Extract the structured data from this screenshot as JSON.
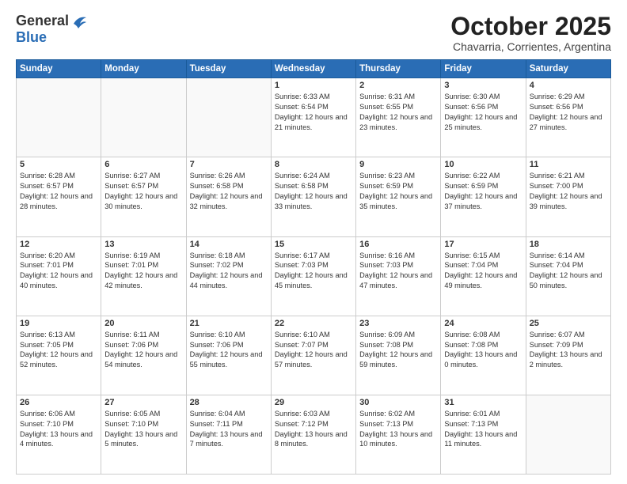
{
  "logo": {
    "general": "General",
    "blue": "Blue"
  },
  "title": "October 2025",
  "subtitle": "Chavarria, Corrientes, Argentina",
  "headers": [
    "Sunday",
    "Monday",
    "Tuesday",
    "Wednesday",
    "Thursday",
    "Friday",
    "Saturday"
  ],
  "weeks": [
    [
      {
        "day": "",
        "info": ""
      },
      {
        "day": "",
        "info": ""
      },
      {
        "day": "",
        "info": ""
      },
      {
        "day": "1",
        "info": "Sunrise: 6:33 AM\nSunset: 6:54 PM\nDaylight: 12 hours\nand 21 minutes."
      },
      {
        "day": "2",
        "info": "Sunrise: 6:31 AM\nSunset: 6:55 PM\nDaylight: 12 hours\nand 23 minutes."
      },
      {
        "day": "3",
        "info": "Sunrise: 6:30 AM\nSunset: 6:56 PM\nDaylight: 12 hours\nand 25 minutes."
      },
      {
        "day": "4",
        "info": "Sunrise: 6:29 AM\nSunset: 6:56 PM\nDaylight: 12 hours\nand 27 minutes."
      }
    ],
    [
      {
        "day": "5",
        "info": "Sunrise: 6:28 AM\nSunset: 6:57 PM\nDaylight: 12 hours\nand 28 minutes."
      },
      {
        "day": "6",
        "info": "Sunrise: 6:27 AM\nSunset: 6:57 PM\nDaylight: 12 hours\nand 30 minutes."
      },
      {
        "day": "7",
        "info": "Sunrise: 6:26 AM\nSunset: 6:58 PM\nDaylight: 12 hours\nand 32 minutes."
      },
      {
        "day": "8",
        "info": "Sunrise: 6:24 AM\nSunset: 6:58 PM\nDaylight: 12 hours\nand 33 minutes."
      },
      {
        "day": "9",
        "info": "Sunrise: 6:23 AM\nSunset: 6:59 PM\nDaylight: 12 hours\nand 35 minutes."
      },
      {
        "day": "10",
        "info": "Sunrise: 6:22 AM\nSunset: 6:59 PM\nDaylight: 12 hours\nand 37 minutes."
      },
      {
        "day": "11",
        "info": "Sunrise: 6:21 AM\nSunset: 7:00 PM\nDaylight: 12 hours\nand 39 minutes."
      }
    ],
    [
      {
        "day": "12",
        "info": "Sunrise: 6:20 AM\nSunset: 7:01 PM\nDaylight: 12 hours\nand 40 minutes."
      },
      {
        "day": "13",
        "info": "Sunrise: 6:19 AM\nSunset: 7:01 PM\nDaylight: 12 hours\nand 42 minutes."
      },
      {
        "day": "14",
        "info": "Sunrise: 6:18 AM\nSunset: 7:02 PM\nDaylight: 12 hours\nand 44 minutes."
      },
      {
        "day": "15",
        "info": "Sunrise: 6:17 AM\nSunset: 7:03 PM\nDaylight: 12 hours\nand 45 minutes."
      },
      {
        "day": "16",
        "info": "Sunrise: 6:16 AM\nSunset: 7:03 PM\nDaylight: 12 hours\nand 47 minutes."
      },
      {
        "day": "17",
        "info": "Sunrise: 6:15 AM\nSunset: 7:04 PM\nDaylight: 12 hours\nand 49 minutes."
      },
      {
        "day": "18",
        "info": "Sunrise: 6:14 AM\nSunset: 7:04 PM\nDaylight: 12 hours\nand 50 minutes."
      }
    ],
    [
      {
        "day": "19",
        "info": "Sunrise: 6:13 AM\nSunset: 7:05 PM\nDaylight: 12 hours\nand 52 minutes."
      },
      {
        "day": "20",
        "info": "Sunrise: 6:11 AM\nSunset: 7:06 PM\nDaylight: 12 hours\nand 54 minutes."
      },
      {
        "day": "21",
        "info": "Sunrise: 6:10 AM\nSunset: 7:06 PM\nDaylight: 12 hours\nand 55 minutes."
      },
      {
        "day": "22",
        "info": "Sunrise: 6:10 AM\nSunset: 7:07 PM\nDaylight: 12 hours\nand 57 minutes."
      },
      {
        "day": "23",
        "info": "Sunrise: 6:09 AM\nSunset: 7:08 PM\nDaylight: 12 hours\nand 59 minutes."
      },
      {
        "day": "24",
        "info": "Sunrise: 6:08 AM\nSunset: 7:08 PM\nDaylight: 13 hours\nand 0 minutes."
      },
      {
        "day": "25",
        "info": "Sunrise: 6:07 AM\nSunset: 7:09 PM\nDaylight: 13 hours\nand 2 minutes."
      }
    ],
    [
      {
        "day": "26",
        "info": "Sunrise: 6:06 AM\nSunset: 7:10 PM\nDaylight: 13 hours\nand 4 minutes."
      },
      {
        "day": "27",
        "info": "Sunrise: 6:05 AM\nSunset: 7:10 PM\nDaylight: 13 hours\nand 5 minutes."
      },
      {
        "day": "28",
        "info": "Sunrise: 6:04 AM\nSunset: 7:11 PM\nDaylight: 13 hours\nand 7 minutes."
      },
      {
        "day": "29",
        "info": "Sunrise: 6:03 AM\nSunset: 7:12 PM\nDaylight: 13 hours\nand 8 minutes."
      },
      {
        "day": "30",
        "info": "Sunrise: 6:02 AM\nSunset: 7:13 PM\nDaylight: 13 hours\nand 10 minutes."
      },
      {
        "day": "31",
        "info": "Sunrise: 6:01 AM\nSunset: 7:13 PM\nDaylight: 13 hours\nand 11 minutes."
      },
      {
        "day": "",
        "info": ""
      }
    ]
  ]
}
